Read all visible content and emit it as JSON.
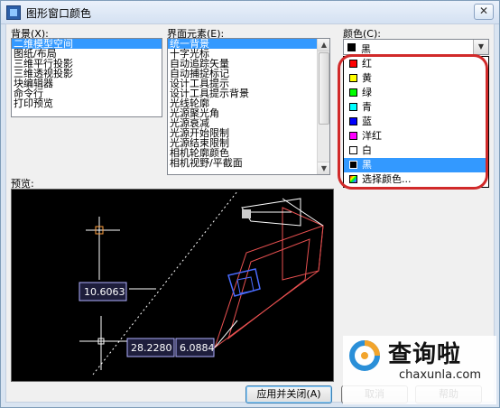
{
  "window": {
    "title": "图形窗口颜色",
    "close_glyph": "✕"
  },
  "background": {
    "label": "背景(X):",
    "items": [
      "二维模型空间",
      "图纸/布局",
      "三维平行投影",
      "三维透视投影",
      "块编辑器",
      "命令行",
      "打印预览"
    ],
    "selected_index": 0
  },
  "elements": {
    "label": "界面元素(E):",
    "items": [
      "统一背景",
      "十字光标",
      "自动追踪矢量",
      "自动捕捉标记",
      "设计工具提示",
      "设计工具提示背景",
      "光线轮廓",
      "光源聚光角",
      "光源衰减",
      "光源开始限制",
      "光源结束限制",
      "相机轮廓颜色",
      "相机视野/平截面"
    ],
    "selected_index": 0
  },
  "color": {
    "label": "颜色(C):",
    "current": "黑",
    "current_color": "#000000",
    "options": [
      {
        "name": "红",
        "color": "#ff0000"
      },
      {
        "name": "黄",
        "color": "#ffff00"
      },
      {
        "name": "绿",
        "color": "#00ff00"
      },
      {
        "name": "青",
        "color": "#00ffff"
      },
      {
        "name": "蓝",
        "color": "#0000ff"
      },
      {
        "name": "洋红",
        "color": "#ff00ff"
      },
      {
        "name": "白",
        "color": "#ffffff"
      },
      {
        "name": "黑",
        "color": "#000000"
      },
      {
        "name": "选择颜色...",
        "color": "multi"
      }
    ],
    "selected_index": 7,
    "highlight_color": "#d12a2a"
  },
  "preview": {
    "label": "预览:",
    "dim_value_1": "10.6063",
    "dim_value_2": "28.2280",
    "dim_value_3": "6.0884"
  },
  "buttons": {
    "apply_close": "应用并关闭(A)",
    "cancel": "取消",
    "help": "帮助"
  },
  "watermark": {
    "text": "查询啦",
    "url": "chaxunla.com"
  }
}
